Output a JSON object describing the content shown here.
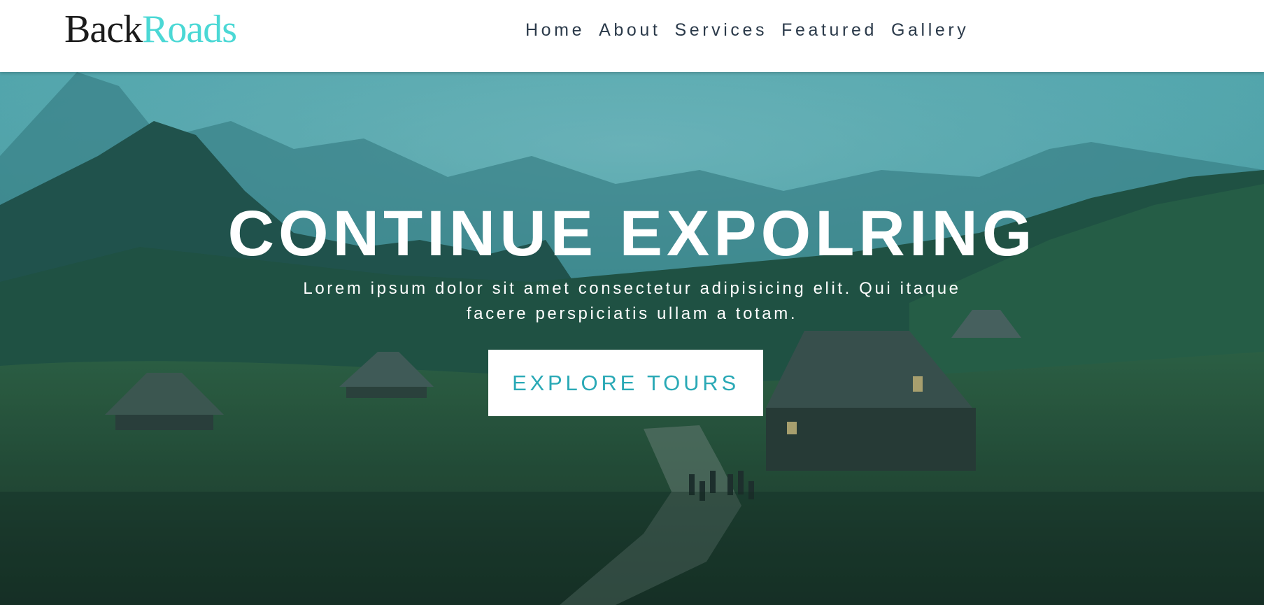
{
  "brand": {
    "part1": "Back",
    "part2": "Roads",
    "accent_color": "#4bd8d5"
  },
  "nav": {
    "items": [
      {
        "label": "Home"
      },
      {
        "label": "About"
      },
      {
        "label": "Services"
      },
      {
        "label": "Featured"
      },
      {
        "label": "Gallery"
      }
    ]
  },
  "hero": {
    "title": "CONTINUE EXPOLRING",
    "text": "Lorem ipsum dolor sit amet consectetur adipisicing elit. Qui itaque facere perspiciatis ullam a totam.",
    "button_label": "EXPLORE TOURS",
    "button_text_color": "#2aa9b6",
    "background_image": "mountain-valley-cabins-hikers-photo"
  }
}
